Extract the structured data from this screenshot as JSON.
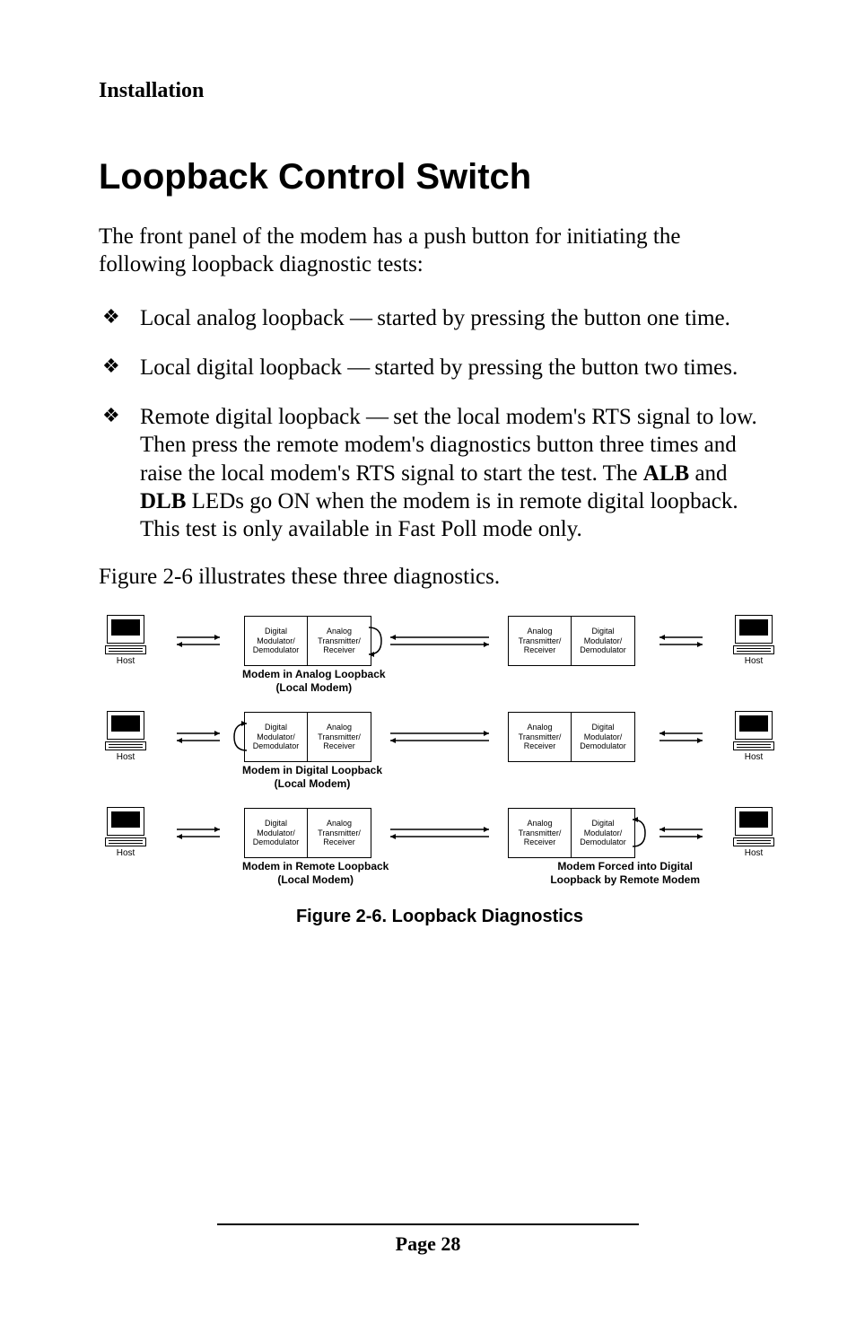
{
  "running_head": "Installation",
  "title": "Loopback Control Switch",
  "intro": "The front panel of the modem has a push button for initiating the following loopback diagnostic tests:",
  "bullets": [
    {
      "pre": "Local analog loopback ",
      "dash": "—",
      "post": " started by pressing the button one time."
    },
    {
      "pre": "Local digital loopback ",
      "dash": "—",
      "post": " started by pressing the button two times."
    },
    {
      "pre": "Remote digital loopback ",
      "dash": "—",
      "post": " set the local modem's RTS signal to low. Then press the remote modem's diagnostics button three times and raise the local modem's RTS signal to start the test. The ",
      "bold1": "ALB",
      "mid": " and ",
      "bold2": "DLB",
      "post2": " LEDs go ON when the modem is in remote digital loopback. This test is only available in Fast Poll mode only."
    }
  ],
  "fig_ref": "Figure 2-6 illustrates these three diagnostics.",
  "labels": {
    "host": "Host",
    "digital_cell": "Digital\nModulator/\nDemodulator",
    "analog_cell": "Analog\nTransmitter/\nReceiver",
    "analog_loopback": "Modem in Analog Loopback\n(Local Modem)",
    "digital_loopback": "Modem in Digital Loopback\n(Local Modem)",
    "remote_loopback": "Modem in Remote Loopback\n(Local Modem)",
    "forced_loopback": "Modem Forced into Digital\nLoopback by Remote Modem"
  },
  "fig_caption": "Figure 2-6. Loopback Diagnostics",
  "page": "Page 28"
}
